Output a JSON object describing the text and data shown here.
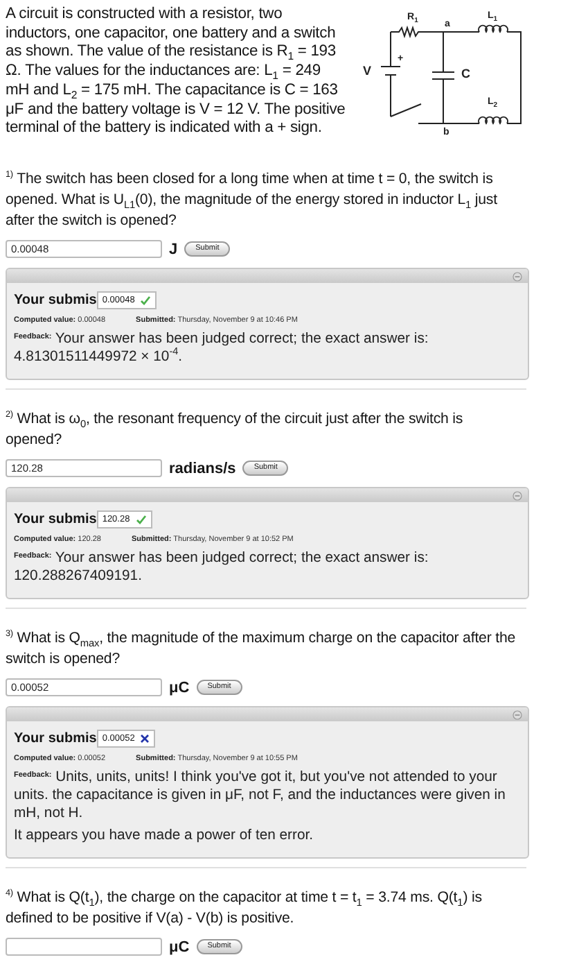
{
  "intro": {
    "text": "A circuit is constructed with a resistor, two inductors, one capacitor, one battery and a switch as shown. The value of the resistance is R$_{1}$ = 193 Ω. The values for the inductances are: L$_{1}$ = 249 mH and L$_{2}$ = 175 mH. The capacitance is C = 163 μF and the battery voltage is V = 12 V. The positive terminal of the battery is indicated with a + sign.",
    "diagram_labels": [
      {
        "kind": "r1",
        "text": "R",
        "sub": "1"
      },
      {
        "kind": "a",
        "text": "a"
      },
      {
        "kind": "l1",
        "text": "L",
        "sub": "1"
      },
      {
        "kind": "v",
        "text": "V"
      },
      {
        "kind": "plus",
        "text": "+"
      },
      {
        "kind": "c",
        "text": "C"
      },
      {
        "kind": "l2",
        "text": "L",
        "sub": "2"
      },
      {
        "kind": "b",
        "text": "b"
      }
    ]
  },
  "questions": [
    {
      "text": "$^{1)}$ The switch has been closed for a long time when at time t = 0, the switch is opened. What is U$_{L1}$(0), the magnitude of the energy stored in inductor L$_{1}$ just after the switch is opened?",
      "value": "0.00048",
      "unit": "J",
      "submit": "Submit",
      "submission": {
        "heading": "Your submis",
        "value": "0.00048",
        "correct": true,
        "computed_label": "Computed value:",
        "computed": "0.00048",
        "submitted_label": "Submitted:",
        "submitted": "Thursday, November 9 at 10:46 PM",
        "feedback_label": "Feedback:",
        "feedback": [
          "Your answer has been judged correct; the exact answer is: 4.81301511449972 × 10$^{-4}$."
        ]
      }
    },
    {
      "text": "$^{2)}$ What is ω$_{0}$, the resonant frequency of the circuit just after the switch is opened?",
      "value": "120.28",
      "unit": "radians/s",
      "submit": "Submit",
      "submission": {
        "heading": "Your submis",
        "value": "120.28",
        "correct": true,
        "computed_label": "Computed value:",
        "computed": "120.28",
        "submitted_label": "Submitted:",
        "submitted": "Thursday, November 9 at 10:52 PM",
        "feedback_label": "Feedback:",
        "feedback": [
          "Your answer has been judged correct; the exact answer is: 120.288267409191."
        ]
      }
    },
    {
      "text": "$^{3)}$ What is Q$_{max}$, the magnitude of the maximum charge on the capacitor after the switch is opened?",
      "value": "0.00052",
      "unit": "μC",
      "submit": "Submit",
      "submission": {
        "heading": "Your submis",
        "value": "0.00052",
        "correct": false,
        "computed_label": "Computed value:",
        "computed": "0.00052",
        "submitted_label": "Submitted:",
        "submitted": "Thursday, November 9 at 10:55 PM",
        "feedback_label": "Feedback:",
        "feedback": [
          "Units, units, units! I think you've got it, but you've not attended to your units. the capacitance is given in μF, not F, and the inductances were given in mH, not H.",
          "It appears you have made a power of ten error."
        ]
      }
    },
    {
      "text": "$^{4)}$ What is Q(t$_{1}$), the charge on the capacitor at time t = t$_{1}$ = 3.74 ms. Q(t$_{1}$) is defined to be positive if V(a) - V(b) is positive.",
      "unit": "μC",
      "submit": "Submit"
    }
  ]
}
